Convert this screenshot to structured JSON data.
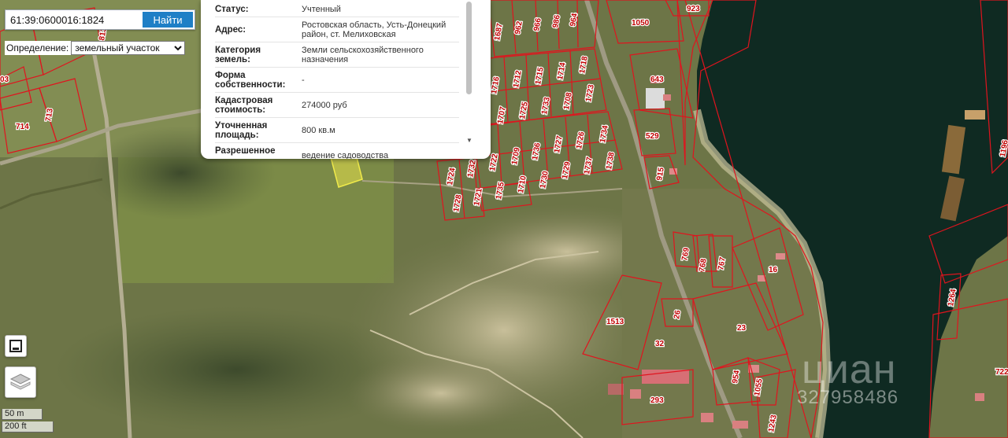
{
  "search": {
    "value": "61:39:0600016:1824",
    "button_label": "Найти"
  },
  "definition": {
    "label": "Определение:",
    "selected": "земельный участок"
  },
  "info_popup": {
    "rows": [
      {
        "label": "Статус:",
        "value": "Учтенный"
      },
      {
        "label": "Адрес:",
        "value": "Ростовская область, Усть-Донецкий район, ст. Мелиховская"
      },
      {
        "label": "Категория земель:",
        "value": "Земли сельскохозяйственного назначения"
      },
      {
        "label": "Форма собственности:",
        "value": "-"
      },
      {
        "label": "Кадастровая стоимость:",
        "value": "274000 руб"
      },
      {
        "label": "Уточненная площадь:",
        "value": "800 кв.м"
      },
      {
        "label": "Разрешенное",
        "value": "ведение садоводства"
      }
    ]
  },
  "controls": {
    "fullscreen_icon": "fullscreen-icon",
    "layers_icon": "layers-icon"
  },
  "scale": {
    "metric": "50 m",
    "imperial": "200 ft"
  },
  "watermark": {
    "brand": "циан",
    "phone": "327958486"
  },
  "parcels": {
    "grid": [
      "1687",
      "962",
      "966",
      "986",
      "964",
      "1716",
      "1712",
      "1715",
      "1714",
      "1718",
      "1707",
      "1725",
      "1733",
      "1708",
      "1723",
      "1709",
      "1736",
      "1727",
      "1726",
      "1734",
      "1724",
      "1732",
      "1722",
      "1710",
      "1730",
      "1729",
      "1737",
      "1738",
      "1728",
      "1721",
      "1735"
    ],
    "left": [
      "714",
      "713",
      "813",
      "03"
    ],
    "east": [
      "1050",
      "923",
      "643",
      "529",
      "915",
      "769",
      "768",
      "767",
      "16",
      "1513",
      "26",
      "32",
      "23",
      "954",
      "1055",
      "293",
      "1243",
      "1264",
      "1196",
      "722"
    ]
  },
  "colors": {
    "parcel_border": "#e0141e",
    "parcel_label": "#c00000",
    "water": "#0f2a22",
    "selected_parcel": "#e8e24a",
    "button": "#1f7fc6"
  }
}
